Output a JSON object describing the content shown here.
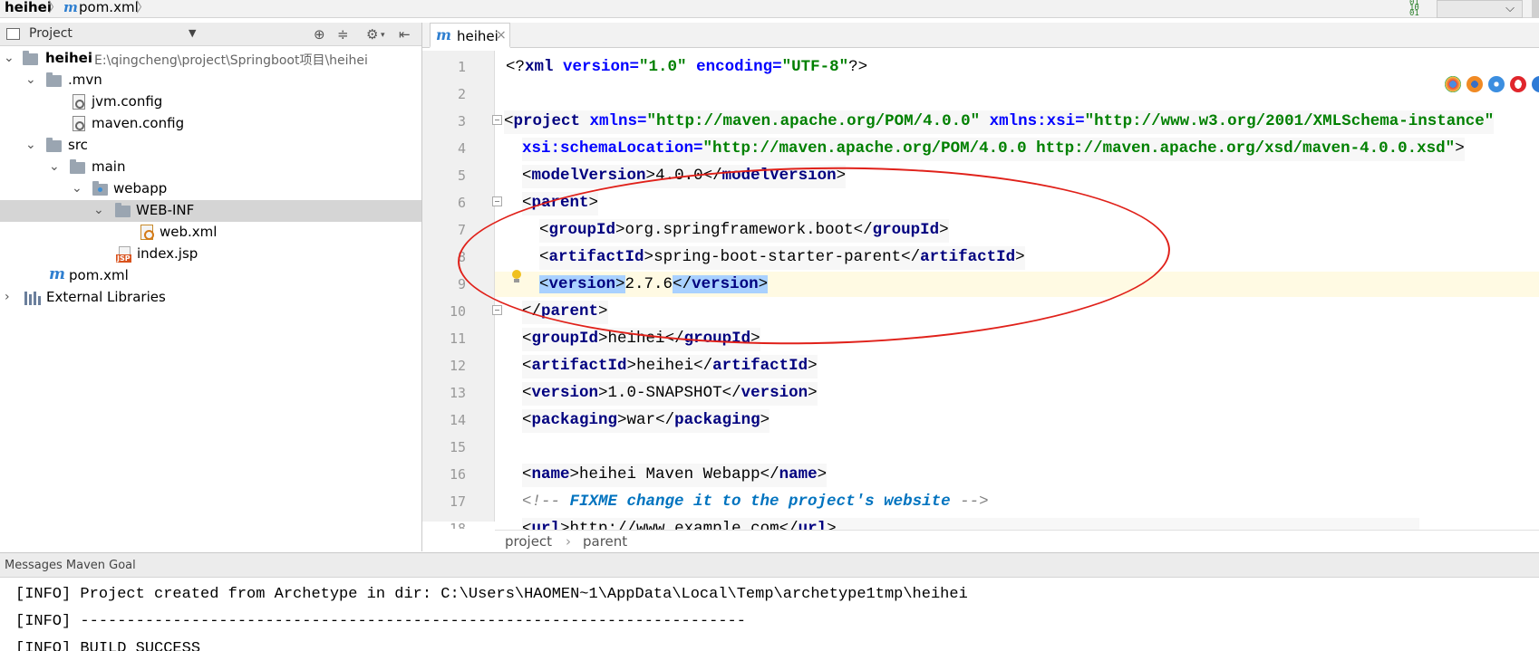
{
  "navbar": {
    "project": "heihei",
    "file": "pom.xml",
    "maven_glyph": "m",
    "sep": "〉",
    "binary_glyph": "01\n10\n01",
    "combo_arrow": "⌵"
  },
  "project_panel": {
    "title": "Project",
    "tree": {
      "root_name": "heihei",
      "root_path": "E:\\qingcheng\\project\\Springboot项目\\heihei",
      "mvn": ".mvn",
      "jvm_config": "jvm.config",
      "maven_config": "maven.config",
      "src": "src",
      "main": "main",
      "webapp": "webapp",
      "web_inf": "WEB-INF",
      "web_xml": "web.xml",
      "index_jsp": "index.jsp",
      "jsp_badge": "JSP",
      "pom_xml": "pom.xml",
      "external_libraries": "External Libraries"
    }
  },
  "editor": {
    "tab_label": "heihei",
    "tab_close": "×",
    "line_numbers": [
      "1",
      "2",
      "3",
      "4",
      "5",
      "6",
      "7",
      "8",
      "9",
      "10",
      "11",
      "12",
      "13",
      "14",
      "15",
      "16",
      "17",
      "18"
    ],
    "code": {
      "l1_decl_open": "<?",
      "l1_xml": "xml",
      "l1_version_attr": " version=",
      "l1_version_val": "\"1.0\"",
      "l1_encoding_attr": " encoding=",
      "l1_encoding_val": "\"UTF-8\"",
      "l1_decl_close": "?>",
      "l3_project": "project",
      "l3_xmlns": " xmlns=",
      "l3_xmlns_val": "\"http://maven.apache.org/POM/4.0.0\"",
      "l3_xsi": " xmlns:xsi=",
      "l3_xsi_val": "\"http://www.w3.org/2001/XMLSchema-instance\"",
      "l4_schema": "xsi:schemaLocation=",
      "l4_schema_val": "\"http://maven.apache.org/POM/4.0.0 http://maven.apache.org/xsd/maven-4.0.0.xsd\"",
      "model_version": "modelVersion",
      "model_version_val": "4.0.0",
      "parent": "parent",
      "group_id": "groupId",
      "artifact_id": "artifactId",
      "version": "version",
      "packaging": "packaging",
      "name": "name",
      "url": "url",
      "parent_group_val": "org.springframework.boot",
      "parent_artifact_val": "spring-boot-starter-parent",
      "parent_version_val": "2.7.6",
      "group_val": "heihei",
      "artifact_val": "heihei",
      "version_val": "1.0-SNAPSHOT",
      "packaging_val": "war",
      "name_val": "heihei Maven Webapp",
      "comment_open": "<!-- ",
      "comment_todo": "FIXME change it to the project's website",
      "comment_close": " -->",
      "url_val": "http://www.example.com"
    },
    "breadcrumb": {
      "project": "project",
      "sep": "›",
      "parent": "parent"
    }
  },
  "messages": {
    "title": "Messages Maven Goal",
    "lines": [
      "[INFO] Project created from Archetype in dir: C:\\Users\\HAOMEN~1\\AppData\\Local\\Temp\\archetype1tmp\\heihei",
      "[INFO] ------------------------------------------------------------------------",
      "[INFO] BUILD SUCCESS"
    ]
  },
  "colors": {
    "tag": "#00007f",
    "attr_name": "#0000ff",
    "attr_value": "#008000",
    "highlight": "#a9d1ff",
    "annotation_ellipse": "#e0211a",
    "maven_icon": "#2f7fd0"
  }
}
